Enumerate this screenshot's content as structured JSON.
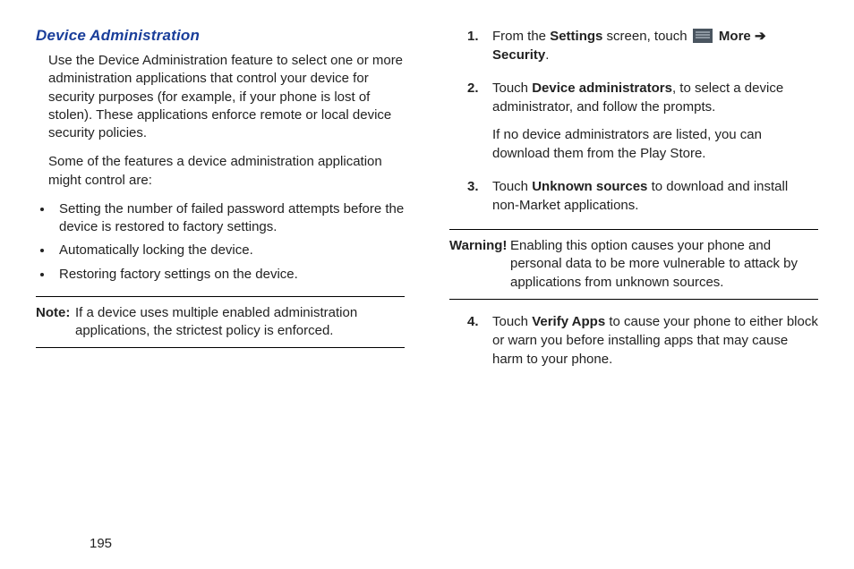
{
  "heading": "Device Administration",
  "intro1": "Use the Device Administration feature to select one or more administration applications that control your device for security purposes (for example, if your phone is lost of stolen). These applications enforce remote or local device security policies.",
  "intro2": "Some of the features a device administration application might control are:",
  "bullets": [
    "Setting the number of failed password attempts before the device is restored to factory settings.",
    "Automatically locking the device.",
    "Restoring factory settings on the device."
  ],
  "note": {
    "label": "Note:",
    "text": "If a device uses multiple enabled administration applications, the strictest policy is enforced."
  },
  "steps": {
    "s1": {
      "num": "1.",
      "pre": "From the ",
      "settings": "Settings",
      "mid": " screen, touch ",
      "more": " More ",
      "arrow": "➔",
      "security": "Security",
      "post": "."
    },
    "s2": {
      "num": "2.",
      "pre": "Touch ",
      "bold": "Device administrators",
      "post": ", to select a device administrator, and follow the prompts.",
      "sub": "If no device administrators are listed, you can download them from the Play Store."
    },
    "s3": {
      "num": "3.",
      "pre": "Touch ",
      "bold": "Unknown sources",
      "post": " to download and install non-Market applications."
    },
    "s4": {
      "num": "4.",
      "pre": "Touch ",
      "bold": "Verify Apps",
      "post": " to cause your phone to either block or warn you before installing apps that may cause harm to your phone."
    }
  },
  "warning": {
    "label": "Warning!",
    "text": "Enabling this option causes your phone and personal data to be more vulnerable to attack by applications from unknown sources."
  },
  "page": "195"
}
